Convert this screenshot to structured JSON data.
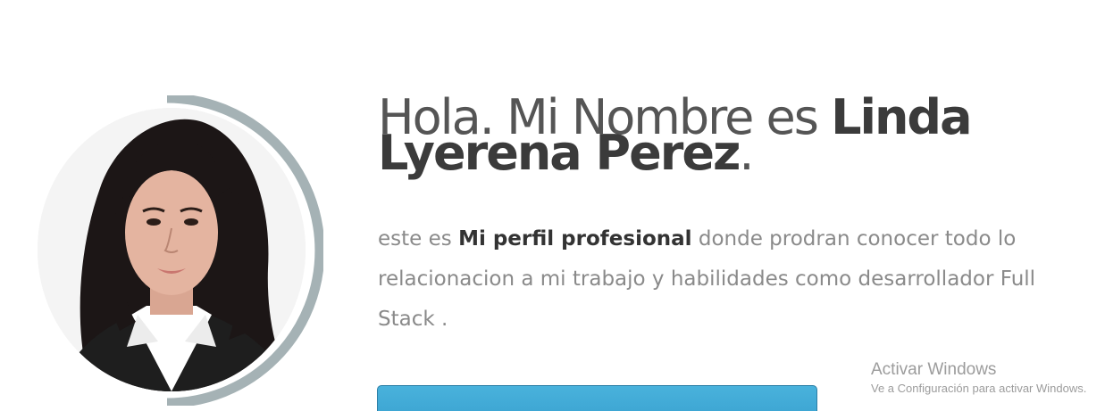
{
  "profile": {
    "greeting": "Hola. Mi Nombre es ",
    "name": "Linda Lyerena Perez",
    "name_display": "Linda Lyerena Perez",
    "period": ".",
    "description_pre": "este es ",
    "description_strong": "Mi perfil profesional",
    "description_post": " donde prodran conocer todo lo relacionacion a mi trabajo y habilidades como desarrollador Full Stack .",
    "button_label": ""
  },
  "watermark": {
    "title": "Activar Windows",
    "subtitle": "Ve a Configuración para activar Windows."
  },
  "colors": {
    "ring": "#a5b2b5",
    "button": "#42abd8",
    "heading": "#414141",
    "body_text": "#8a8a8a"
  }
}
